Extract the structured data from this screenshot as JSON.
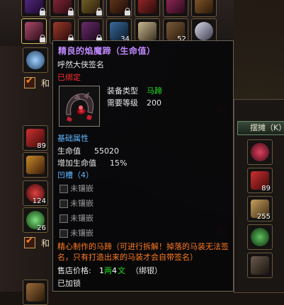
{
  "tooltip": {
    "title": "精良的焰魔蹄（生命值）",
    "signature": "呼然大侠签名",
    "bound": "已绑定",
    "type_label": "装备类型",
    "type_value": "马蹄",
    "level_label": "需要等级",
    "level_value": "200",
    "basic_attr": "基础属性",
    "hp_label": "生命值",
    "hp_value": "55020",
    "hp_pct_label": "增加生命值",
    "hp_pct_value": "15%",
    "groove_label": "凹槽（4）",
    "sockets": [
      "未镶嵌",
      "未镶嵌",
      "未镶嵌",
      "未镶嵌"
    ],
    "description": "精心制作的马蹄（可进行拆解！掉落的马装无法签名，只有打造出来的马装才会自带签名）",
    "price_label": "售店价格:",
    "price_amount_1": "1",
    "price_unit_1": "两",
    "price_amount_2": "4",
    "price_unit_2": "文",
    "price_bind": "（绑银）",
    "locked": "已加锁"
  },
  "inventory": {
    "counts": [
      "34",
      "52",
      "89",
      "124",
      "26",
      "89",
      "255"
    ],
    "he_label": "和"
  },
  "stall": {
    "tab": "摆摊（K）",
    "close_glyph": "✕"
  }
}
